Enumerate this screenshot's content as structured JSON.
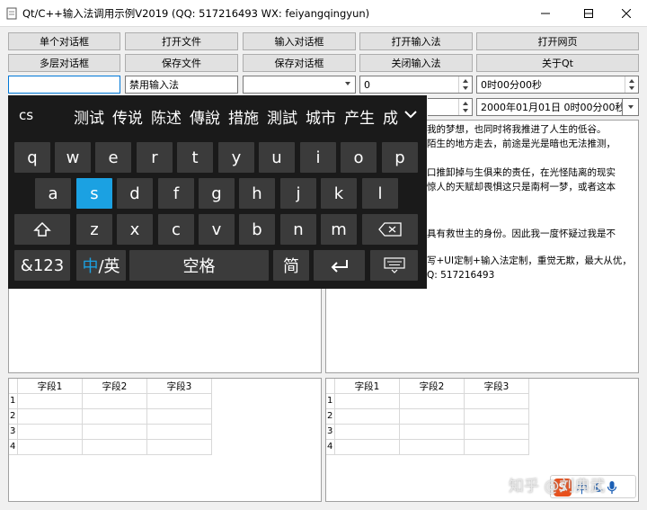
{
  "window": {
    "title": "Qt/C++输入法调用示例V2019 (QQ: 517216493  WX: feiyangqingyun)",
    "minimize_icon": "minimize-icon",
    "maximize_icon": "maximize-icon",
    "close_icon": "close-icon"
  },
  "toolbar": {
    "row1": [
      "单个对话框",
      "打开文件",
      "输入对话框",
      "打开输入法",
      "打开网页"
    ],
    "row2": [
      "多层对话框",
      "保存文件",
      "保存对话框",
      "关闭输入法",
      "关于Qt"
    ]
  },
  "inputs": {
    "text_field_value": "",
    "disabled_ime_field": "禁用输入法",
    "combo_value": "",
    "spin_value": "0",
    "time_value": "0时00分00秒",
    "datetime_value": "2000年01月01日 0时00分00秒"
  },
  "text_pane_right": {
    "lines": [
      "我的梦想，也同时将我推进了人生的低谷。",
      "陌生的地方走去，前途是光是暗也无法推测，",
      "",
      "口推卸掉与生俱来的责任，在光怪陆离的现实",
      "惊人的天赋却畏惧这只是南柯一梦，或者这本",
      "",
      "",
      "具有救世主的身份。因此我一度怀疑过我是不",
      "",
      "写+UI定制+输入法定制，重觉无欺，最大从优，",
      "Q:  517216493"
    ]
  },
  "keyboard": {
    "candidate_input": "cs",
    "candidates": [
      "测试",
      "传说",
      "陈述",
      "傳說",
      "措施",
      "測試",
      "城市",
      "产生",
      "成"
    ],
    "expand_icon": "chevron-down-icon",
    "row1": [
      "q",
      "w",
      "e",
      "r",
      "t",
      "y",
      "u",
      "i",
      "o",
      "p"
    ],
    "row2": [
      "a",
      "s",
      "d",
      "f",
      "g",
      "h",
      "j",
      "k",
      "l"
    ],
    "row3": [
      "z",
      "x",
      "c",
      "v",
      "b",
      "n",
      "m"
    ],
    "shift_icon": "shift-arrow-icon",
    "backspace_icon": "backspace-icon",
    "num_label": "&123",
    "lang_label_active": "中",
    "lang_label_rest": "/英",
    "space_label": "空格",
    "simp_label": "简",
    "enter_icon": "enter-icon",
    "hide_icon": "keyboard-hide-icon",
    "active_key": "s"
  },
  "tables": {
    "headers": [
      "字段1",
      "字段2",
      "字段3"
    ],
    "row_numbers": [
      "1",
      "2",
      "3",
      "4"
    ]
  },
  "watermark": {
    "text": "知乎 @刘典武",
    "ime_badge_text": "中"
  },
  "colors": {
    "accent": "#1ba1e2",
    "keyboard_bg": "#1a1a1a",
    "key_bg": "#3b3b3b",
    "focus_border": "#0078d7"
  }
}
